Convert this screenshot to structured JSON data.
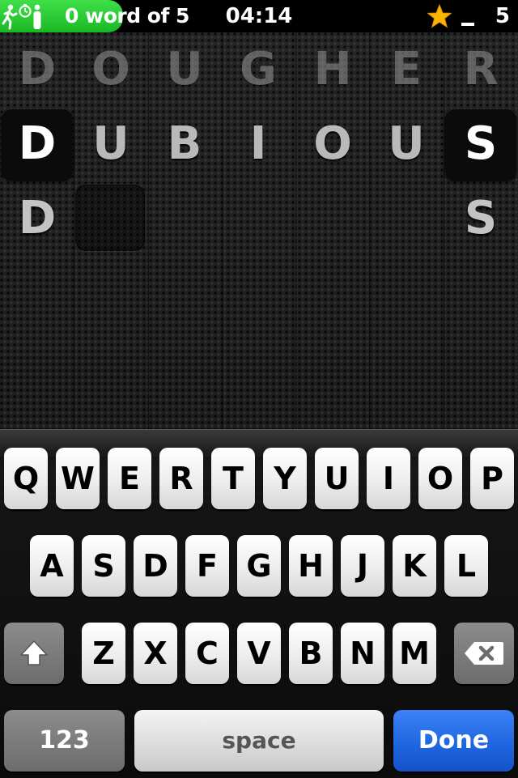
{
  "status_bar": {
    "progress_text": "0 word of 5",
    "progress_icon": "runner-stopwatch-icon",
    "progress_color": "#22c42e",
    "time": "04:14",
    "star_icon": "star-icon",
    "star_color": "#f7b500",
    "dash": "_",
    "score": "5"
  },
  "board": {
    "rows": [
      {
        "letters": [
          "D",
          "O",
          "U",
          "G",
          "H",
          "E",
          "R"
        ]
      },
      {
        "letters": [
          "D",
          "U",
          "B",
          "I",
          "O",
          "U",
          "S"
        ],
        "highlighted_columns": [
          0,
          6
        ]
      },
      {
        "letters": [
          "D",
          "",
          "",
          "",
          "",
          "",
          "S"
        ]
      }
    ]
  },
  "keyboard": {
    "row1": [
      "Q",
      "W",
      "E",
      "R",
      "T",
      "Y",
      "U",
      "I",
      "O",
      "P"
    ],
    "row2": [
      "A",
      "S",
      "D",
      "F",
      "G",
      "H",
      "J",
      "K",
      "L"
    ],
    "row3": [
      "Z",
      "X",
      "C",
      "V",
      "B",
      "N",
      "M"
    ],
    "shift_icon": "shift-arrow-icon",
    "backspace_icon": "backspace-icon",
    "numbers_label": "123",
    "space_label": "space",
    "done_label": "Done",
    "done_color": "#1d64e0"
  }
}
